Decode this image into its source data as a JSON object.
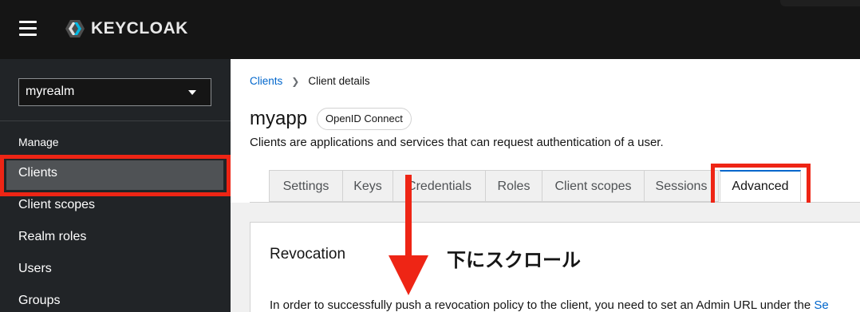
{
  "header": {
    "logo_text": "KEYCLOAK",
    "menu_icon": "hamburger-icon"
  },
  "sidebar": {
    "realm": "myrealm",
    "section_title": "Manage",
    "items": [
      {
        "label": "Clients",
        "active": true
      },
      {
        "label": "Client scopes"
      },
      {
        "label": "Realm roles"
      },
      {
        "label": "Users"
      },
      {
        "label": "Groups"
      }
    ]
  },
  "breadcrumb": {
    "link": "Clients",
    "current": "Client details"
  },
  "page": {
    "title": "myapp",
    "badge": "OpenID Connect",
    "subtitle": "Clients are applications and services that can request authentication of a user."
  },
  "tabs": [
    {
      "label": "Settings"
    },
    {
      "label": "Keys"
    },
    {
      "label": "Credentials"
    },
    {
      "label": "Roles"
    },
    {
      "label": "Client scopes"
    },
    {
      "label": "Sessions"
    },
    {
      "label": "Advanced",
      "active": true
    }
  ],
  "card": {
    "title": "Revocation",
    "body": "In order to successfully push a revocation policy to the client, you need to set an Admin URL under the ",
    "body_link": "Se"
  },
  "annotation": {
    "text": "下にスクロール"
  },
  "colors": {
    "highlight": "#ee2515",
    "link": "#0066cc",
    "header_bg": "#151515",
    "sidebar_bg": "#212427"
  }
}
